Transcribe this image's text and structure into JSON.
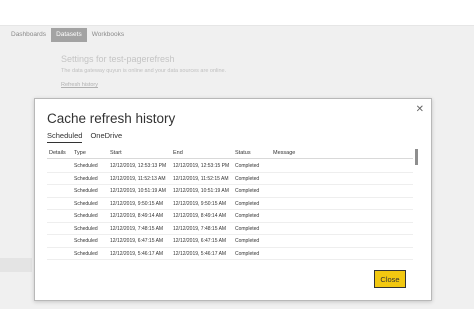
{
  "nav": {
    "tabs": [
      "Dashboards",
      "Datasets",
      "Workbooks"
    ],
    "active_tab": "Datasets"
  },
  "settings": {
    "title": "Settings for test-pagerefresh",
    "description": "The data gateway quyun is online and your data sources are online.",
    "link": "Refresh history"
  },
  "dialog": {
    "title": "Cache refresh history",
    "tabs": [
      "Scheduled",
      "OneDrive"
    ],
    "active_tab": "Scheduled",
    "columns": [
      "Details",
      "Type",
      "Start",
      "End",
      "Status",
      "Message"
    ],
    "rows": [
      [
        "",
        "Scheduled",
        "12/12/2019, 12:53:13 PM",
        "12/12/2019, 12:53:15 PM",
        "Completed",
        ""
      ],
      [
        "",
        "Scheduled",
        "12/12/2019, 11:52:13 AM",
        "12/12/2019, 11:52:15 AM",
        "Completed",
        ""
      ],
      [
        "",
        "Scheduled",
        "12/12/2019, 10:51:19 AM",
        "12/12/2019, 10:51:19 AM",
        "Completed",
        ""
      ],
      [
        "",
        "Scheduled",
        "12/12/2019, 9:50:15 AM",
        "12/12/2019, 9:50:15 AM",
        "Completed",
        ""
      ],
      [
        "",
        "Scheduled",
        "12/12/2019, 8:49:14 AM",
        "12/12/2019, 8:49:14 AM",
        "Completed",
        ""
      ],
      [
        "",
        "Scheduled",
        "12/12/2019, 7:48:15 AM",
        "12/12/2019, 7:48:15 AM",
        "Completed",
        ""
      ],
      [
        "",
        "Scheduled",
        "12/12/2019, 6:47:15 AM",
        "12/12/2019, 6:47:15 AM",
        "Completed",
        ""
      ],
      [
        "",
        "Scheduled",
        "12/12/2019, 5:46:17 AM",
        "12/12/2019, 5:46:17 AM",
        "Completed",
        ""
      ]
    ],
    "close_icon": "✕",
    "close_button": "Close"
  },
  "colors": {
    "accent_button": "#f2c811",
    "active_tab_bg": "#a3a3a3"
  }
}
